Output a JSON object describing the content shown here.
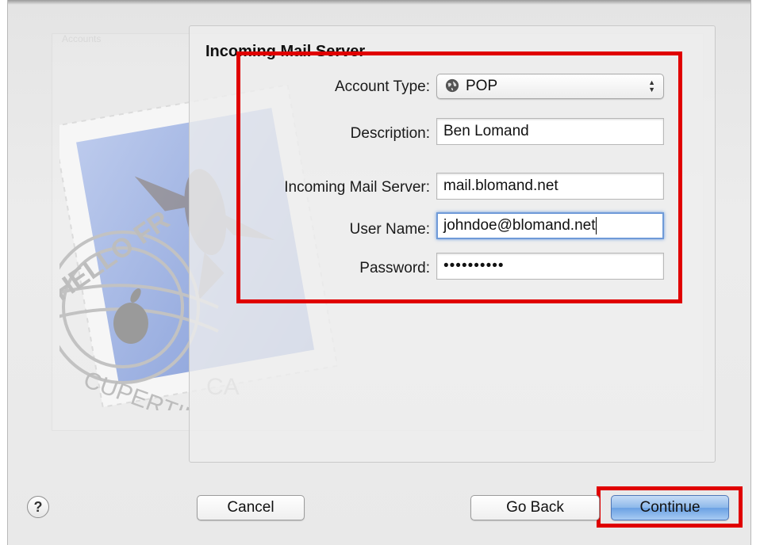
{
  "panel": {
    "title": "Incoming Mail Server"
  },
  "form": {
    "account_type": {
      "label": "Account Type:",
      "value": "POP",
      "icon": "globe-icon"
    },
    "description": {
      "label": "Description:",
      "value": "Ben Lomand"
    },
    "incoming_server": {
      "label": "Incoming Mail Server:",
      "value": "mail.blomand.net"
    },
    "user_name": {
      "label": "User Name:",
      "value": "johndoe@blomand.net"
    },
    "password": {
      "label": "Password:",
      "value": "••••••••••"
    }
  },
  "stamp": {
    "postmark_top": "HELLO FR",
    "postmark_bottom": "CUPERTINO",
    "postmark_state": "CA",
    "background_label": "Accounts"
  },
  "buttons": {
    "help": "?",
    "cancel": "Cancel",
    "go_back": "Go Back",
    "continue": "Continue"
  },
  "colors": {
    "highlight": "#e00000",
    "focus_ring": "#6f9ad8",
    "default_button": "#8db8ea"
  }
}
